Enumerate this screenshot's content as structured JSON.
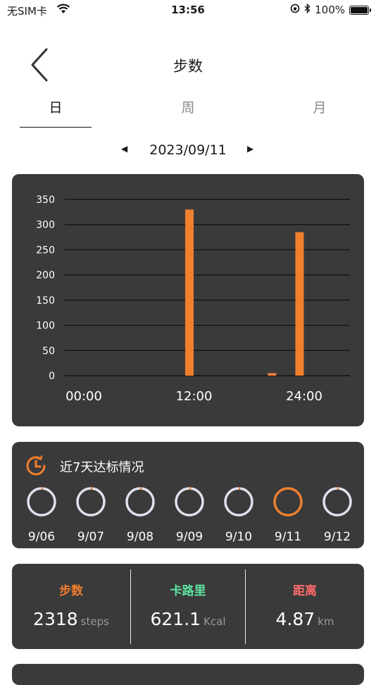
{
  "status": {
    "carrier": "无SIM卡",
    "time": "13:56",
    "battery": "100%"
  },
  "header": {
    "title": "步数"
  },
  "tabs": [
    {
      "label": "日",
      "active": true
    },
    {
      "label": "周",
      "active": false
    },
    {
      "label": "月",
      "active": false
    }
  ],
  "date_nav": {
    "prev": "◀",
    "date": "2023/09/11",
    "next": "▶"
  },
  "chart_data": {
    "type": "bar",
    "y_ticks": [
      "350",
      "300",
      "250",
      "200",
      "150",
      "100",
      "50",
      "0"
    ],
    "ylim": [
      0,
      350
    ],
    "x_ticks": [
      "00:00",
      "12:00",
      "24:00"
    ],
    "bars": [
      {
        "hour": 11,
        "value": 330
      },
      {
        "hour": 20,
        "value": 5
      },
      {
        "hour": 23,
        "value": 285
      }
    ],
    "color": "#f07f2e",
    "grid": true
  },
  "goals": {
    "title": "近7天达标情况",
    "days": [
      {
        "label": "9/06",
        "progress": 0.02
      },
      {
        "label": "9/07",
        "progress": 0.02
      },
      {
        "label": "9/08",
        "progress": 0.02
      },
      {
        "label": "9/09",
        "progress": 0.02
      },
      {
        "label": "9/10",
        "progress": 0.02
      },
      {
        "label": "9/11",
        "progress": 1.0
      },
      {
        "label": "9/12",
        "progress": 0.02
      }
    ],
    "ring_color": "#dfe2ee",
    "progress_color": "#f07f2e"
  },
  "stats": [
    {
      "label": "步数",
      "value": "2318",
      "unit": "steps",
      "color": "#f07f2e"
    },
    {
      "label": "卡路里",
      "value": "621.1",
      "unit": "Kcal",
      "color": "#5fe3a1"
    },
    {
      "label": "距离",
      "value": "4.87",
      "unit": "km",
      "color": "#ff6b6b"
    }
  ]
}
